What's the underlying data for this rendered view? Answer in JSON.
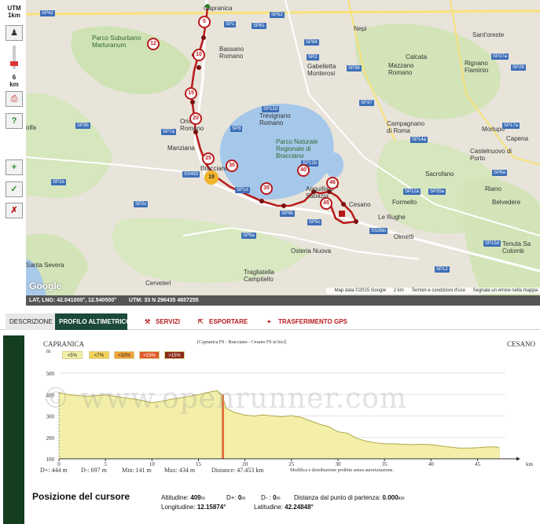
{
  "toolbar": {
    "utm_label": "UTM",
    "scale_label": "1km",
    "zoom_label": "6",
    "zoom_unit": "km"
  },
  "map": {
    "places": [
      "Capranica",
      "Nepi",
      "Sant'oreste",
      "Parco Suburbano Marturanum",
      "Bassano Romano",
      "Gabelletta Monterosi",
      "Calcata",
      "Mazzano Romano",
      "Rignano Flaminio",
      "Trevignano Romano",
      "Parco Naturale Regionale di Bracciano",
      "Campagnano di Roma",
      "Morlupo",
      "Capena",
      "Castelnuovo di Porto",
      "Oriolo Romano",
      "Manziana",
      "Sacrofano",
      "Riano",
      "Formello",
      "Belvedere",
      "Cesano",
      "Le Rughe",
      "Olmetti",
      "Osteria Nuova",
      "Tenuta Sa Colomb",
      "Santa Severa",
      "Tragliatella Campitello",
      "Cerveteri",
      "Anguillara Sabazia",
      "Bracciano",
      "olfa"
    ],
    "roads": [
      "SP42",
      "SP52",
      "SP1",
      "SP81",
      "SP84",
      "SR2",
      "SP38",
      "SP27a",
      "SP28",
      "SP37",
      "SP12d",
      "SP3b",
      "SP7a",
      "SP8",
      "SP14a",
      "SP17a",
      "SP6a",
      "SP12b",
      "SP1d",
      "SS493",
      "SP2c",
      "SP12a",
      "SP35a",
      "SP15d",
      "SS2bis",
      "SP5c",
      "SP12",
      "SP5a",
      "SP1b",
      "SP4b"
    ],
    "markers": [
      "5",
      "10",
      "12",
      "15",
      "20",
      "25",
      "30",
      "35",
      "40",
      "45",
      "46",
      "18"
    ],
    "footer": [
      "Map data ©2015 Google",
      "2 km",
      "Termini e condizioni d'uso",
      "Segnala un errore nella mappa"
    ],
    "google": "Google"
  },
  "coords": {
    "latlng_label": "LAT, LNG:",
    "latlng_value": "42.041000°, 12.540500°",
    "utm_label": "UTM:",
    "utm_value": "33 N  296435  4657255"
  },
  "tabs": {
    "description": "DESCRIZIONE",
    "profile": "PROFILO ALTIMETRICO",
    "services": "SERVIZI",
    "export": "ESPORTARE",
    "gps": "TRASFERIMENTO GPS"
  },
  "elevation": {
    "start": "CAPRANICA",
    "end": "CESANO",
    "route": "[Capranica FS - Bracciano - Cesano FS in bici]",
    "legend": [
      "<5%",
      "<7%",
      "<10%",
      "<15%",
      ">15%"
    ],
    "legend_colors": [
      "#f3efa8",
      "#f2d05a",
      "#f0a23a",
      "#e05a2a",
      "#8a2a18"
    ],
    "m_label": "m",
    "km_label": "km",
    "watermark": "© www.openrunner.com",
    "stats": {
      "dplus": "D+: 444 m",
      "dminus": "D-: 697 m",
      "min": "Min: 141 m",
      "max": "Max: 434 m",
      "distance": "Distance: 47.453 km",
      "notice": "Modifica e distribuzione proibite senza autorizzazione."
    }
  },
  "chart_data": {
    "type": "area",
    "title": "[Capranica FS - Bracciano - Cesano FS in bici]",
    "xlabel": "km",
    "ylabel": "m",
    "xlim": [
      0,
      48
    ],
    "ylim": [
      100,
      500
    ],
    "x_ticks": [
      0,
      5,
      10,
      15,
      20,
      25,
      30,
      35,
      40,
      45
    ],
    "y_ticks": [
      100,
      200,
      300,
      400,
      500
    ],
    "x": [
      0,
      1,
      2,
      3,
      4,
      5,
      6,
      7,
      8,
      9,
      10,
      11,
      12,
      13,
      14,
      15,
      16,
      17,
      17.5,
      18,
      19,
      20,
      21,
      22,
      23,
      24,
      25,
      26,
      27,
      28,
      29,
      30,
      31,
      32,
      33,
      34,
      35,
      36,
      37,
      38,
      39,
      40,
      41,
      42,
      43,
      44,
      45,
      46,
      47,
      47.4
    ],
    "y": [
      409,
      400,
      395,
      392,
      395,
      398,
      392,
      385,
      380,
      372,
      362,
      368,
      378,
      384,
      392,
      400,
      410,
      418,
      400,
      335,
      315,
      304,
      300,
      305,
      300,
      297,
      302,
      294,
      278,
      262,
      250,
      226,
      220,
      196,
      182,
      175,
      170,
      170,
      168,
      166,
      168,
      166,
      160,
      155,
      150,
      150,
      152,
      155,
      156,
      150
    ]
  },
  "cursor": {
    "title": "Posizione del cursore",
    "alt_label": "Altitudine:",
    "alt_value": "409",
    "alt_unit": "m",
    "dplus_label": "D+:",
    "dplus_value": "0",
    "dplus_unit": "m",
    "dminus_label": "D- :",
    "dminus_value": "0",
    "dminus_unit": "m",
    "dist_label": "Distanza dal punto di partenza:",
    "dist_value": "0.000",
    "dist_unit": "km",
    "lon_label": "Longitudine:",
    "lon_value": "12.15874°",
    "lat_label": "Latitudine:",
    "lat_value": "42.24848°"
  }
}
